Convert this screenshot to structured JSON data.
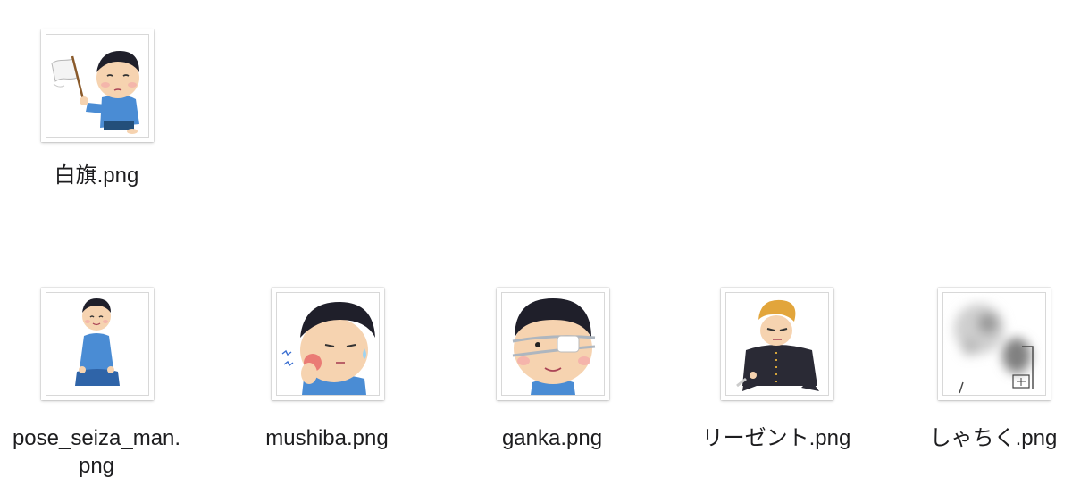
{
  "files": [
    {
      "name": "白旗.png",
      "icon": "white-flag-person-icon"
    },
    {
      "name": "pose_seiza_man.",
      "name_line2": "png",
      "icon": "seiza-man-icon"
    },
    {
      "name": "mushiba.png",
      "icon": "toothache-boy-icon"
    },
    {
      "name": "ganka.png",
      "icon": "eye-patch-boy-icon"
    },
    {
      "name": "リーゼント.png",
      "icon": "regent-delinquent-icon"
    },
    {
      "name": "しゃちく.png",
      "icon": "blurred-drawing-icon"
    }
  ],
  "colors": {
    "thumb_border": "#d8d8d8",
    "label_text": "#1d1d1f",
    "shirt_blue": "#4a8cd4",
    "hair": "#1f1f2a"
  }
}
